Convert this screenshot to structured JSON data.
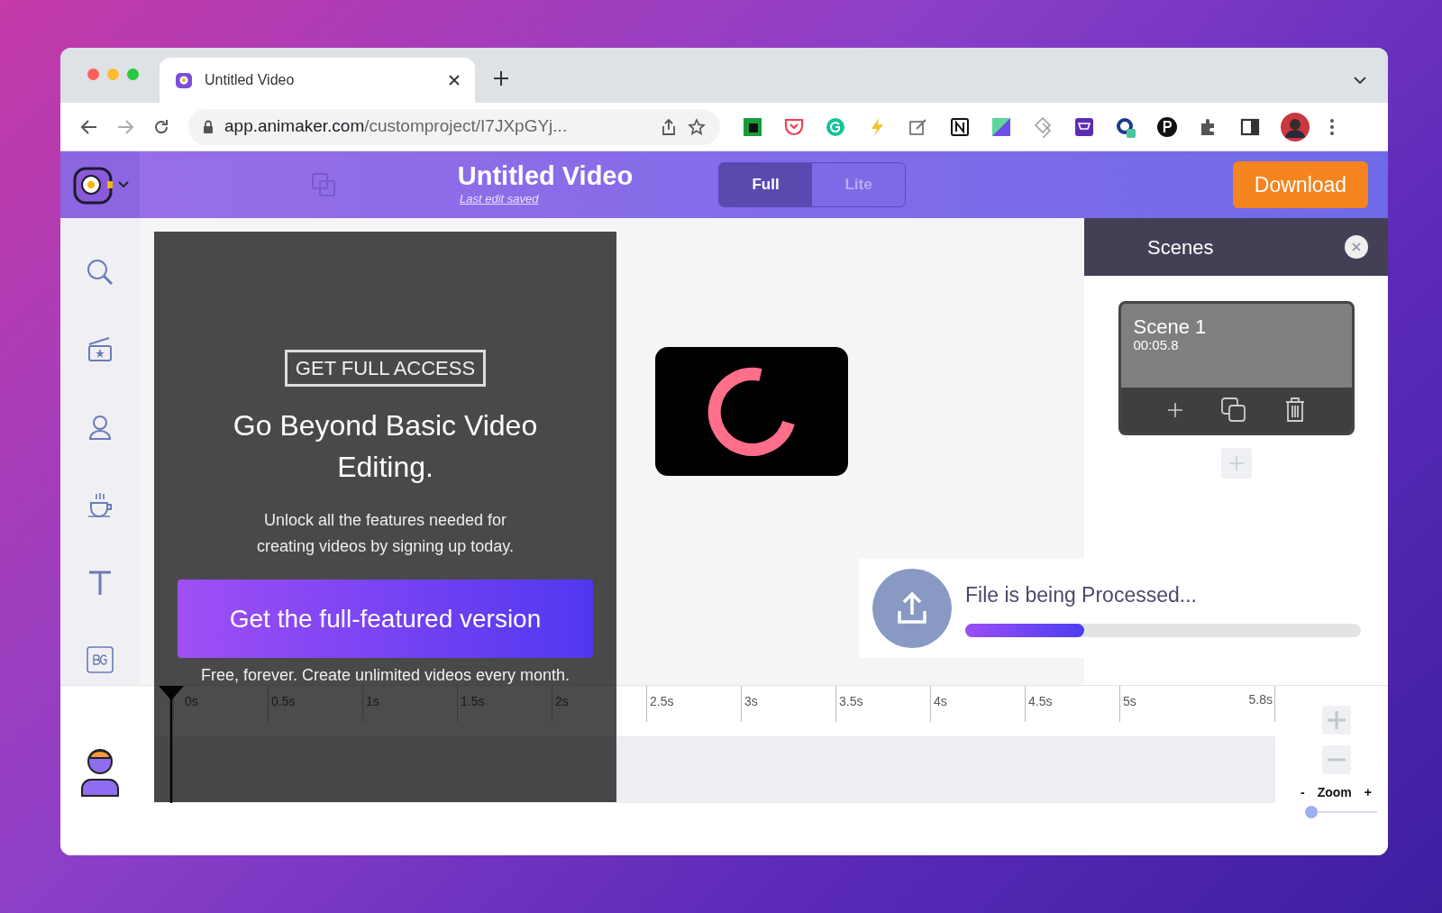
{
  "browser": {
    "tab_title": "Untitled Video",
    "url_host": "app.animaker.com",
    "url_path": "/customproject/I7JXpGYj..."
  },
  "header": {
    "title": "Untitled Video",
    "subtitle": "Last edit saved",
    "modes": [
      {
        "label": "Full",
        "selected": true
      },
      {
        "label": "Lite",
        "selected": false
      }
    ],
    "download": "Download"
  },
  "promo": {
    "badge": "GET FULL ACCESS",
    "heading": "Go Beyond Basic Video Editing.",
    "body": "Unlock all the features needed for creating videos by signing up today.",
    "cta": "Get the full-featured version",
    "note": "Free, forever. Create unlimited videos every month."
  },
  "scenes": {
    "title": "Scenes",
    "items": [
      {
        "name": "Scene 1",
        "duration": "00:05.8"
      }
    ]
  },
  "upload": {
    "message": "File is being Processed...",
    "level": 0.3
  },
  "timeline": {
    "ticks": [
      "0s",
      "0.5s",
      "1s",
      "1.5s",
      "2s",
      "2.5s",
      "3s",
      "3.5s",
      "4s",
      "4.5s",
      "5s",
      "5.8s"
    ]
  },
  "zoom": {
    "minus": "-",
    "label": "Zoom",
    "plus": "+",
    "level": 0
  }
}
